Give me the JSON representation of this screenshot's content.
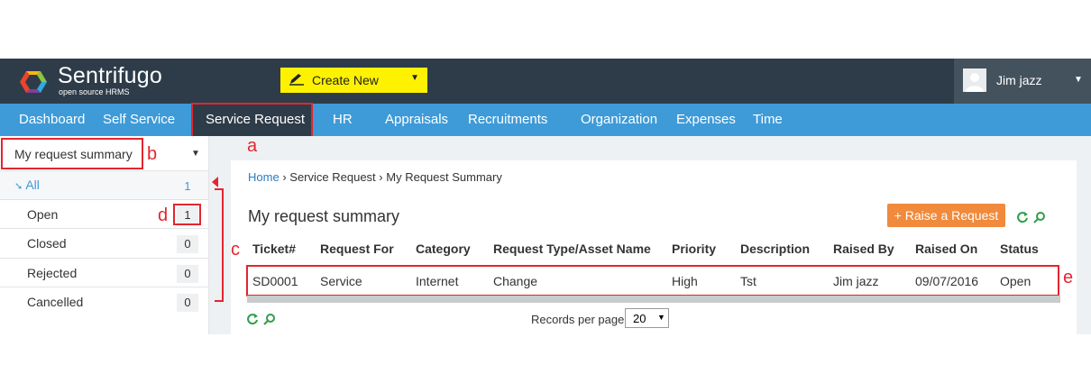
{
  "app": {
    "name": "Sentrifugo",
    "tagline": "open source HRMS"
  },
  "header": {
    "create_new_label": "Create New",
    "user_name": "Jim jazz"
  },
  "nav": {
    "dashboard": "Dashboard",
    "self_service": "Self Service",
    "service_request": "Service Request",
    "hr": "HR",
    "appraisals": "Appraisals",
    "recruitments": "Recruitments",
    "organization": "Organization",
    "expenses": "Expenses",
    "time": "Time"
  },
  "sidebar": {
    "selected": "My request summary",
    "items": [
      {
        "label": "All",
        "count": "1"
      },
      {
        "label": "Open",
        "count": "1"
      },
      {
        "label": "Closed",
        "count": "0"
      },
      {
        "label": "Rejected",
        "count": "0"
      },
      {
        "label": "Cancelled",
        "count": "0"
      }
    ]
  },
  "breadcrumb": {
    "home": "Home",
    "sep1": "›",
    "section": "Service Request",
    "sep2": "›",
    "page": "My Request Summary"
  },
  "main": {
    "title": "My request summary",
    "raise_button": "+ Raise a Request",
    "columns": [
      "Ticket#",
      "Request For",
      "Category",
      "Request Type/Asset Name",
      "Priority",
      "Description",
      "Raised By",
      "Raised On",
      "Status"
    ],
    "rows": [
      [
        "SD0001",
        "Service",
        "Internet",
        "Change",
        "High",
        "Tst",
        "Jim jazz",
        "09/07/2016",
        "Open"
      ]
    ],
    "records_per_page_label": "Records per page",
    "records_per_page_value": "20"
  },
  "annotations": {
    "a": "a",
    "b": "b",
    "c": "c",
    "d": "d",
    "e": "e"
  },
  "colors": {
    "header": "#2e3c49",
    "nav": "#3e9bd8",
    "accent_yellow": "#fff200",
    "raise_button": "#f08a3c",
    "annotation": "#e2262e",
    "link": "#2a7bbf"
  }
}
